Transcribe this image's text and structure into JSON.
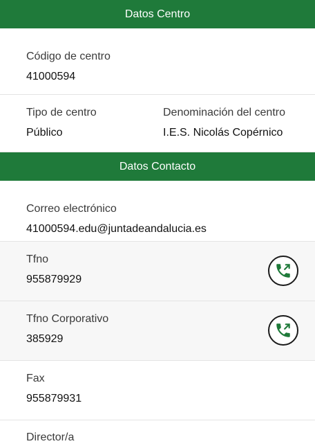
{
  "datos_centro": {
    "header": "Datos Centro",
    "codigo_label": "Código de centro",
    "codigo_value": "41000594",
    "tipo_label": "Tipo de centro",
    "tipo_value": "Público",
    "denominacion_label": "Denominación del centro",
    "denominacion_value": "I.E.S. Nicolás Copérnico"
  },
  "datos_contacto": {
    "header": "Datos Contacto",
    "correo_label": "Correo electrónico",
    "correo_value": "41000594.edu@juntadeandalucia.es",
    "tfno_label": "Tfno",
    "tfno_value": "955879929",
    "tfno_corp_label": "Tfno Corporativo",
    "tfno_corp_value": "385929",
    "fax_label": "Fax",
    "fax_value": "955879931",
    "director_label": "Director/a"
  },
  "icons": {
    "call": "phone-call-icon"
  },
  "colors": {
    "header_bg": "#1f7a3a",
    "icon_green": "#1f7a3a"
  }
}
